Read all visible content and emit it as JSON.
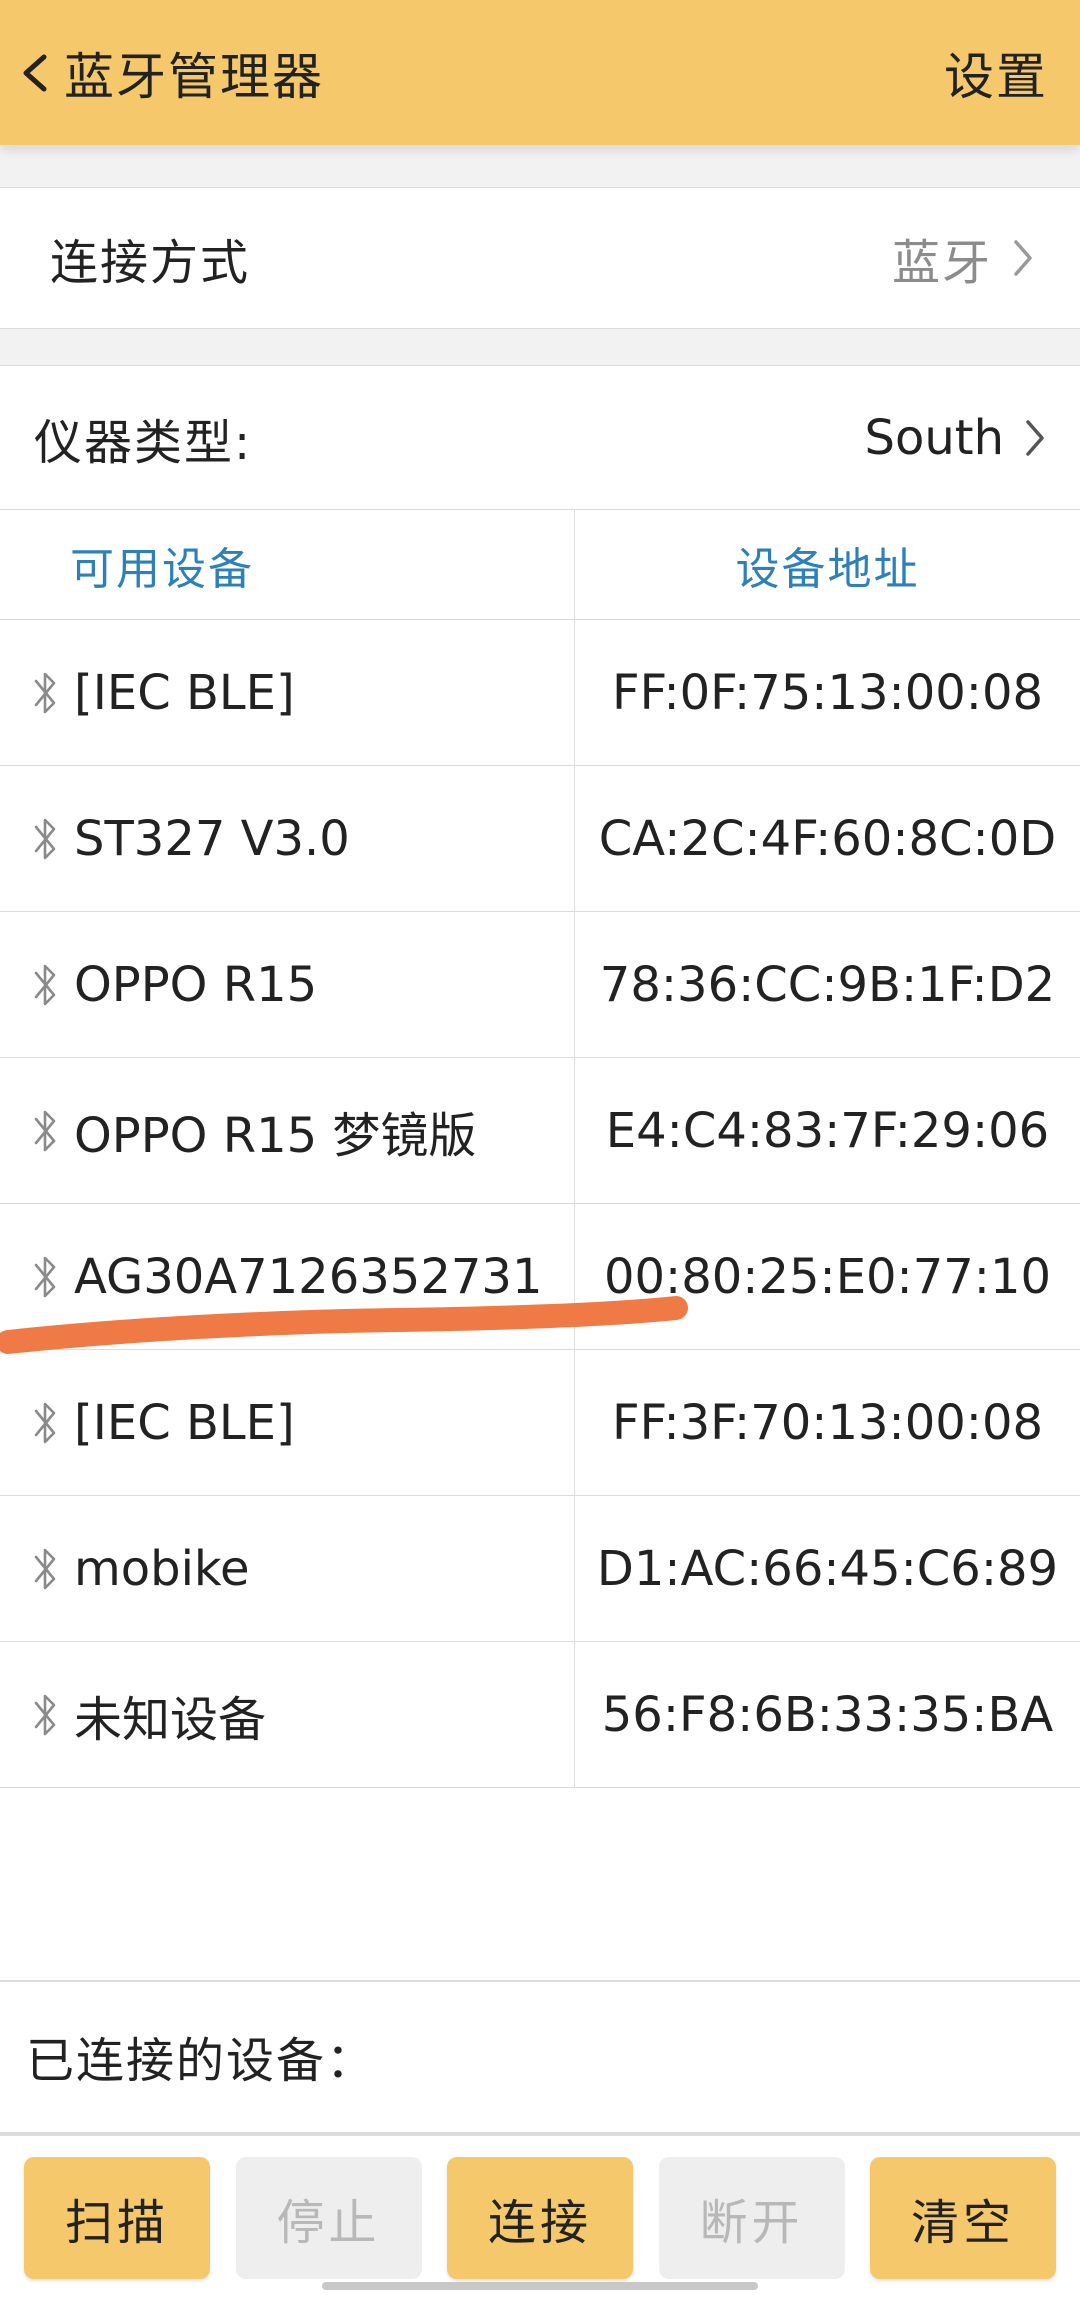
{
  "header": {
    "title": "蓝牙管理器",
    "settings_label": "设置"
  },
  "connection": {
    "label": "连接方式",
    "value": "蓝牙"
  },
  "instrument": {
    "label": "仪器类型:",
    "value": "South"
  },
  "table": {
    "headers": {
      "name": "可用设备",
      "address": "设备地址"
    },
    "rows": [
      {
        "name": "[IEC BLE]",
        "address": "FF:0F:75:13:00:08"
      },
      {
        "name": "ST327 V3.0",
        "address": "CA:2C:4F:60:8C:0D"
      },
      {
        "name": "OPPO R15",
        "address": "78:36:CC:9B:1F:D2"
      },
      {
        "name": "OPPO R15 梦镜版",
        "address": "E4:C4:83:7F:29:06"
      },
      {
        "name": "AG30A7126352731",
        "address": "00:80:25:E0:77:10"
      },
      {
        "name": "[IEC BLE]",
        "address": "FF:3F:70:13:00:08"
      },
      {
        "name": "mobike",
        "address": "D1:AC:66:45:C6:89"
      },
      {
        "name": "未知设备",
        "address": "56:F8:6B:33:35:BA"
      }
    ]
  },
  "connected": {
    "label": "已连接的设备："
  },
  "buttons": {
    "scan": "扫描",
    "stop": "停止",
    "connect": "连接",
    "disconnect": "断开",
    "clear": "清空"
  },
  "icons": {
    "back": "chevron-left-icon",
    "chevron": "chevron-right-icon",
    "bluetooth": "bluetooth-icon"
  },
  "colors": {
    "accent": "#f5c86b",
    "header_text": "#2d80b8",
    "annotation": "#f07a45",
    "disabled": "#b8b8b8"
  }
}
